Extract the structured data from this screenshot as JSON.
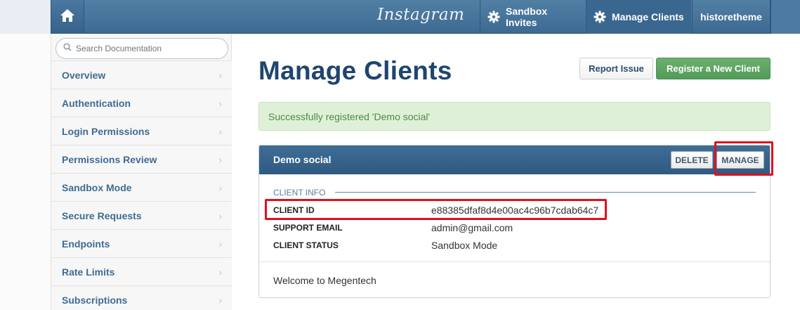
{
  "topbar": {
    "logo_text": "Instagram",
    "nav": [
      {
        "label": "Sandbox Invites",
        "icon": "gear-icon"
      },
      {
        "label": "Manage Clients",
        "icon": "gear-icon",
        "active": true
      },
      {
        "label": "historetheme"
      }
    ],
    "home_icon": "home-icon"
  },
  "sidebar": {
    "search_placeholder": "Search Documentation",
    "items": [
      {
        "label": "Overview"
      },
      {
        "label": "Authentication"
      },
      {
        "label": "Login Permissions"
      },
      {
        "label": "Permissions Review"
      },
      {
        "label": "Sandbox Mode"
      },
      {
        "label": "Secure Requests"
      },
      {
        "label": "Endpoints"
      },
      {
        "label": "Rate Limits"
      },
      {
        "label": "Subscriptions"
      }
    ]
  },
  "main": {
    "title": "Manage Clients",
    "report_issue_label": "Report Issue",
    "register_label": "Register a New Client",
    "alert_text": "Successfully registered 'Demo social'",
    "client": {
      "name": "Demo social",
      "delete_label": "DELETE",
      "manage_label": "MANAGE",
      "section_label": "CLIENT INFO",
      "rows": [
        {
          "key": "CLIENT ID",
          "value": "e88385dfaf8d4e00ac4c96b7cdab64c7"
        },
        {
          "key": "SUPPORT EMAIL",
          "value": "admin@gmail.com"
        },
        {
          "key": "CLIENT STATUS",
          "value": "Sandbox Mode"
        }
      ],
      "description": "Welcome to Megentech"
    }
  },
  "colors": {
    "header": "#3d6a92",
    "link": "#3f6b94",
    "title": "#1f4570",
    "success_bg": "#dff0d8",
    "success_text": "#4e8a45",
    "register_button": "#5aa35f",
    "highlight": "#e0101c"
  }
}
